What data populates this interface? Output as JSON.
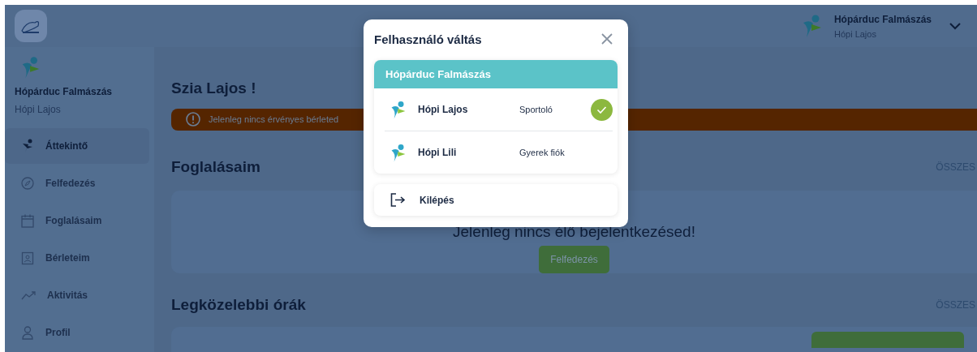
{
  "header": {
    "club": "Hópárduc Falmászás",
    "user": "Hópi Lajos"
  },
  "sidebar": {
    "club": "Hópárduc Falmászás",
    "user": "Hópi Lajos",
    "items": [
      {
        "label": "Áttekintő",
        "selected": true
      },
      {
        "label": "Felfedezés",
        "selected": false
      },
      {
        "label": "Foglalásaim",
        "selected": false
      },
      {
        "label": "Bérleteim",
        "selected": false
      },
      {
        "label": "Aktivitás",
        "selected": false
      },
      {
        "label": "Profil",
        "selected": false
      }
    ]
  },
  "main": {
    "greeting": "Szia Lajos !",
    "notice": "Jelenleg nincs érvényes bérleted",
    "bookings": {
      "title": "Foglalásaim",
      "link": "ÖSSZES",
      "message": "Jelenleg nincs élő bejelentkezésed!",
      "button": "Felfedezés"
    },
    "upcoming": {
      "title": "Legközelebbi órák",
      "link": "ÖSSZES"
    }
  },
  "modal": {
    "title": "Felhasználó váltás",
    "club": "Hópárduc Falmászás",
    "accounts": [
      {
        "name": "Hópi Lajos",
        "role": "Sportoló",
        "selected": true
      },
      {
        "name": "Hópi Lili",
        "role": "Gyerek fiók",
        "selected": false
      }
    ],
    "logout": "Kilépés"
  }
}
